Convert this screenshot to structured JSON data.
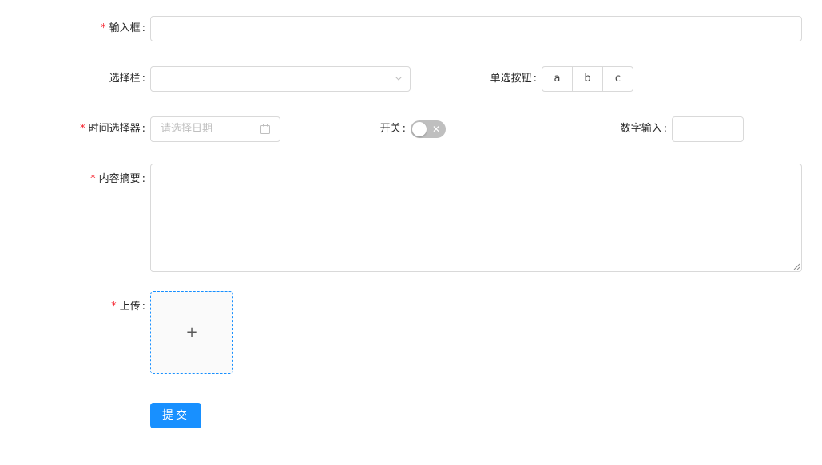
{
  "form": {
    "input_field": {
      "label": "输入框",
      "required": true,
      "value": ""
    },
    "select_field": {
      "label": "选择栏",
      "required": false,
      "value": ""
    },
    "radio_field": {
      "label": "单选按钮",
      "required": false,
      "options": [
        "a",
        "b",
        "c"
      ]
    },
    "date_field": {
      "label": "时间选择器",
      "required": true,
      "placeholder": "请选择日期"
    },
    "switch_field": {
      "label": "开关",
      "required": false,
      "checked": false,
      "off_symbol": "✕"
    },
    "number_field": {
      "label": "数字输入",
      "required": false,
      "value": ""
    },
    "summary_field": {
      "label": "内容摘要",
      "required": true,
      "value": ""
    },
    "upload_field": {
      "label": "上传",
      "required": true,
      "plus": "+"
    },
    "submit_label": "提交"
  },
  "colors": {
    "primary": "#1890ff",
    "required": "#f5222d",
    "border": "#d9d9d9",
    "switch_off": "#bfbfbf"
  },
  "icons": {
    "select": "chevron-down-icon",
    "date": "calendar-icon",
    "upload": "plus-icon"
  }
}
